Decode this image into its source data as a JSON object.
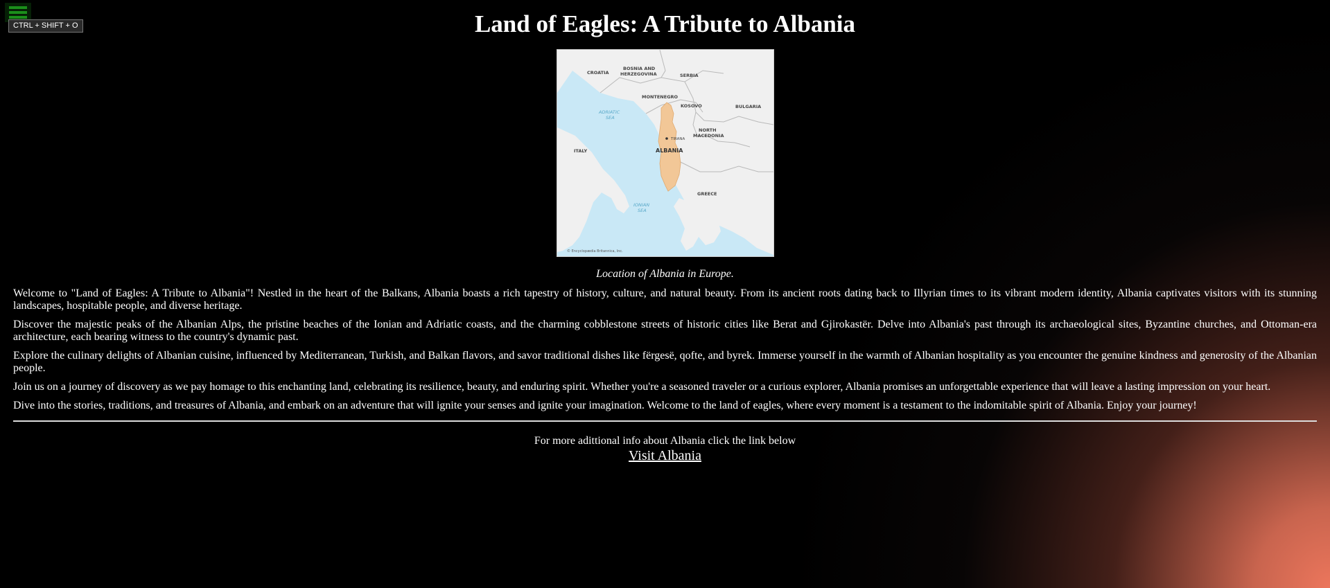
{
  "page": {
    "title": "Land of Eagles: A Tribute to Albania",
    "menu_icon": "hamburger-icon",
    "shortcut_hint": "CTRL + SHIFT + O"
  },
  "figure": {
    "caption": "Location of Albania in Europe.",
    "map_labels": {
      "croatia": "CROATIA",
      "bosnia_1": "BOSNIA AND",
      "bosnia_2": "HERZEGOVINA",
      "serbia": "SERBIA",
      "montenegro": "MONTENEGRO",
      "kosovo": "KOSOVO",
      "bulgaria": "BULGARIA",
      "adriatic_1": "ADRIATIC",
      "adriatic_2": "SEA",
      "tirana": "TIRANA",
      "north_macedonia_1": "NORTH",
      "north_macedonia_2": "MACEDONIA",
      "italy": "ITALY",
      "albania": "ALBANIA",
      "greece": "GREECE",
      "ionian_1": "IONIAN",
      "ionian_2": "SEA",
      "credit": "© Encyclopædia Britannica, Inc."
    }
  },
  "paragraphs": [
    "Welcome to \"Land of Eagles: A Tribute to Albania\"! Nestled in the heart of the Balkans, Albania boasts a rich tapestry of history, culture, and natural beauty. From its ancient roots dating back to Illyrian times to its vibrant modern identity, Albania captivates visitors with its stunning landscapes, hospitable people, and diverse heritage.",
    "Discover the majestic peaks of the Albanian Alps, the pristine beaches of the Ionian and Adriatic coasts, and the charming cobblestone streets of historic cities like Berat and Gjirokastër. Delve into Albania's past through its archaeological sites, Byzantine churches, and Ottoman-era architecture, each bearing witness to the country's dynamic past.",
    "Explore the culinary delights of Albanian cuisine, influenced by Mediterranean, Turkish, and Balkan flavors, and savor traditional dishes like fërgesë, qofte, and byrek. Immerse yourself in the warmth of Albanian hospitality as you encounter the genuine kindness and generosity of the Albanian people.",
    "Join us on a journey of discovery as we pay homage to this enchanting land, celebrating its resilience, beauty, and enduring spirit. Whether you're a seasoned traveler or a curious explorer, Albania promises an unforgettable experience that will leave a lasting impression on your heart.",
    "Dive into the stories, traditions, and treasures of Albania, and embark on an adventure that will ignite your senses and ignite your imagination. Welcome to the land of eagles, where every moment is a testament to the indomitable spirit of Albania. Enjoy your journey!"
  ],
  "footer": {
    "info_text": "For more adittional info about Albania click the link below",
    "link_label": "Visit Albania"
  },
  "colors": {
    "sea": "#c9e8f6",
    "land": "#f0f0f0",
    "albania": "#f2c797",
    "glow": "#ec765c",
    "menu_bar": "#1b8f1b"
  }
}
